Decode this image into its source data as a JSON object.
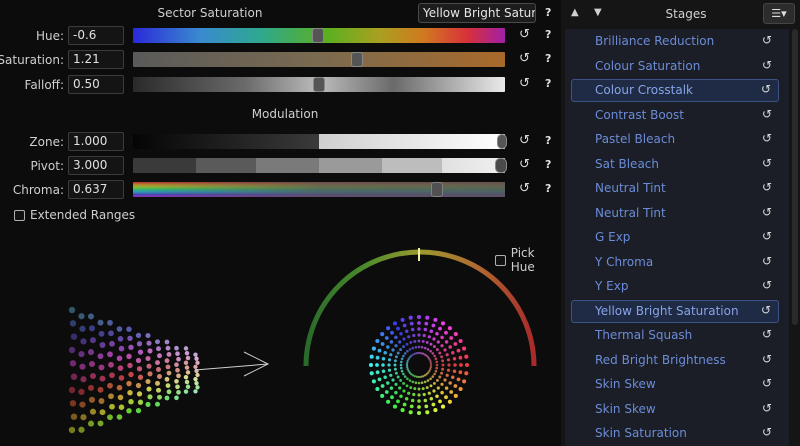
{
  "panel": {
    "sector_title": "Sector Saturation",
    "modulation_title": "Modulation",
    "stage_select": "Yellow Bright Saturation",
    "help": "?",
    "reset_glyph": "↺"
  },
  "controls": [
    {
      "label": "Hue:",
      "value": "-0.6",
      "gradient": "hue",
      "position": 0.49
    },
    {
      "label": "Saturation:",
      "value": "1.21",
      "gradient": "sat",
      "position": 0.605
    },
    {
      "label": "Falloff:",
      "value": "0.50",
      "gradient": "falloff",
      "position": 0.5
    }
  ],
  "modulation": [
    {
      "label": "Zone:",
      "value": "1.000",
      "gradient": "zone",
      "position": 1.0
    },
    {
      "label": "Pivot:",
      "value": "3.000",
      "gradient": "pivot",
      "position": 1.0
    },
    {
      "label": "Chroma:",
      "value": "0.637",
      "gradient": "chroma",
      "position": 0.82
    }
  ],
  "extended_ranges": {
    "label": "Extended Ranges",
    "checked": false
  },
  "pick_hue": {
    "label": "Pick Hue",
    "checked": false
  },
  "stages": {
    "title": "Stages",
    "up_icon": "▲",
    "down_icon": "▼",
    "menu_icon": "☰▾",
    "items": [
      {
        "label": "Brilliance Reduction",
        "selected": false
      },
      {
        "label": "Colour Saturation",
        "selected": false
      },
      {
        "label": "Colour Crosstalk",
        "selected": true
      },
      {
        "label": "Contrast Boost",
        "selected": false
      },
      {
        "label": "Pastel Bleach",
        "selected": false
      },
      {
        "label": "Sat Bleach",
        "selected": false
      },
      {
        "label": "Neutral Tint",
        "selected": false
      },
      {
        "label": "Neutral Tint",
        "selected": false
      },
      {
        "label": "G Exp",
        "selected": false
      },
      {
        "label": "Y Chroma",
        "selected": false
      },
      {
        "label": "Y Exp",
        "selected": false
      },
      {
        "label": "Yellow Bright Saturation",
        "selected": true
      },
      {
        "label": "Thermal Squash",
        "selected": false
      },
      {
        "label": "Red Bright Brightness",
        "selected": false
      },
      {
        "label": "Skin Skew",
        "selected": false
      },
      {
        "label": "Skin Skew",
        "selected": false
      },
      {
        "label": "Skin Saturation",
        "selected": false
      }
    ]
  },
  "colors": {
    "stage_text": "#6b8cd8",
    "selected_bg": "#1f2a44",
    "selected_border": "#3d5386",
    "hue_marker": "#f0f0a0"
  }
}
